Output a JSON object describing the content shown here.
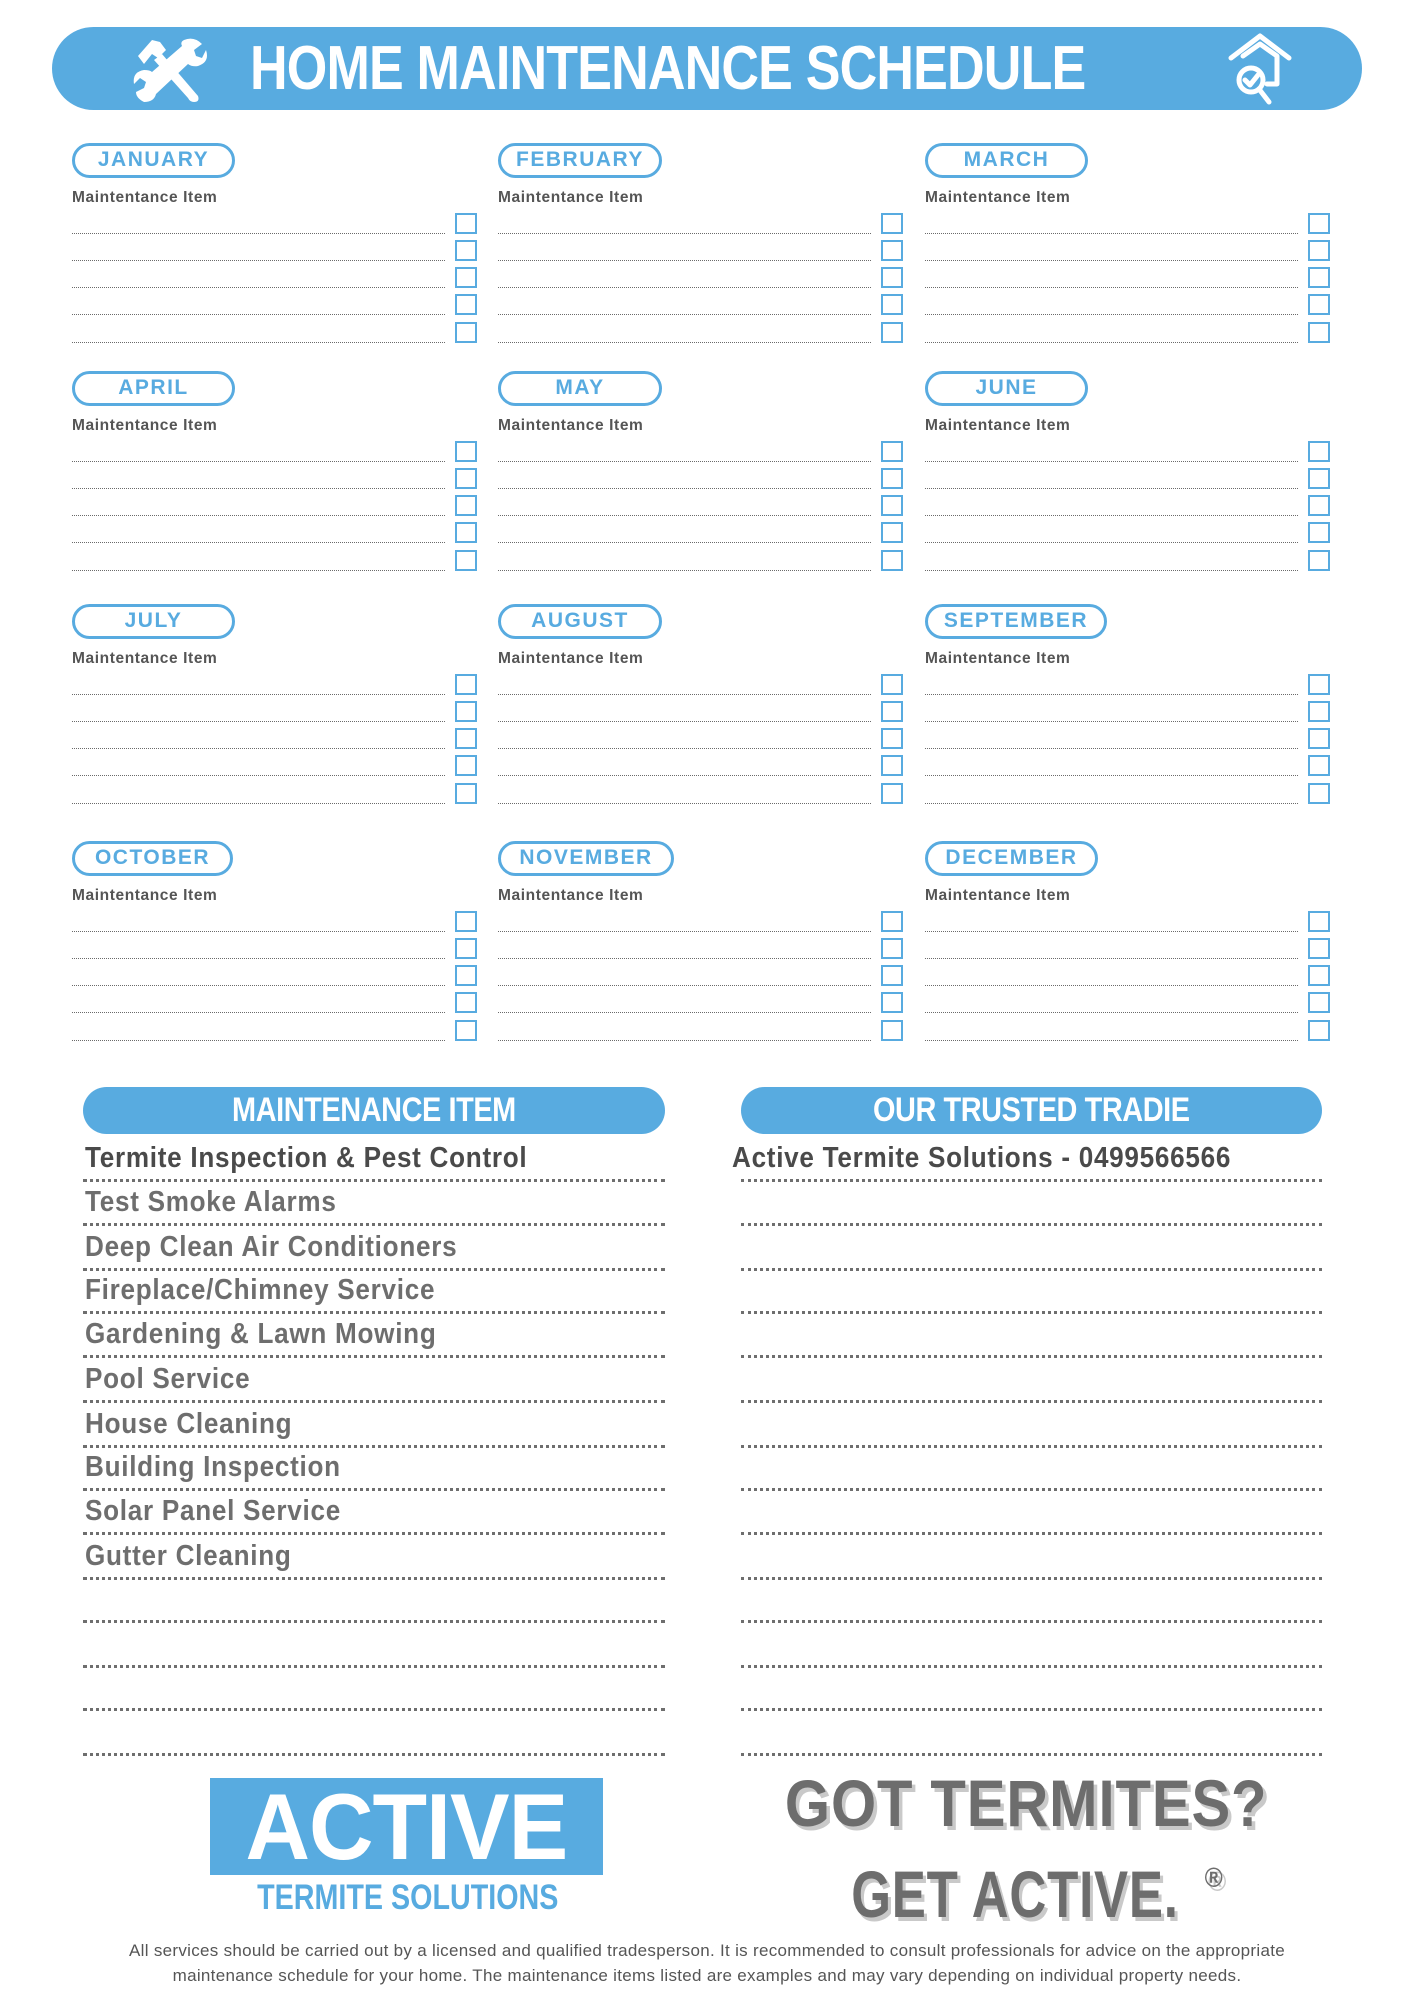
{
  "header": {
    "title": "HOME MAINTENANCE SCHEDULE",
    "left_icon": "tools-icon",
    "right_icon": "house-inspection-icon",
    "accent_color": "#58abe0"
  },
  "months": [
    {
      "name": "JANUARY",
      "label": "Maintentance Item",
      "rows": 5
    },
    {
      "name": "FEBRUARY",
      "label": "Maintentance Item",
      "rows": 5
    },
    {
      "name": "MARCH",
      "label": "Maintentance Item",
      "rows": 5
    },
    {
      "name": "APRIL",
      "label": "Maintentance Item",
      "rows": 5
    },
    {
      "name": "MAY",
      "label": "Maintentance Item",
      "rows": 5
    },
    {
      "name": "JUNE",
      "label": "Maintentance Item",
      "rows": 5
    },
    {
      "name": "JULY",
      "label": "Maintentance Item",
      "rows": 5
    },
    {
      "name": "AUGUST",
      "label": "Maintentance Item",
      "rows": 5
    },
    {
      "name": "SEPTEMBER",
      "label": "Maintentance Item",
      "rows": 5
    },
    {
      "name": "OCTOBER",
      "label": "Maintentance Item",
      "rows": 5
    },
    {
      "name": "NOVEMBER",
      "label": "Maintentance Item",
      "rows": 5
    },
    {
      "name": "DECEMBER",
      "label": "Maintentance Item",
      "rows": 5
    }
  ],
  "maintenance_list": {
    "title": "MAINTENANCE ITEM",
    "items": [
      "Termite Inspection & Pest Control",
      "Test Smoke Alarms",
      "Deep Clean Air Conditioners",
      "Fireplace/Chimney Service",
      "Gardening & Lawn Mowing",
      "Pool Service",
      "House Cleaning",
      "Building Inspection",
      "Solar Panel Service",
      "Gutter Cleaning",
      "",
      "",
      "",
      ""
    ]
  },
  "tradie_list": {
    "title": "OUR TRUSTED TRADIE",
    "items": [
      "Active Termite Solutions - 0499566566",
      "",
      "",
      "",
      "",
      "",
      "",
      "",
      "",
      "",
      "",
      "",
      "",
      ""
    ]
  },
  "logo": {
    "main": "ACTIVE",
    "sub": "TERMITE SOLUTIONS"
  },
  "slogan": {
    "line1": "GOT TERMITES?",
    "line2": "GET ACTIVE.",
    "mark": "®"
  },
  "disclaimer": {
    "line1": "All services should be carried out by a licensed and qualified tradesperson. It is recommended to consult professionals for advice on the appropriate",
    "line2": "maintenance schedule for your home. The maintenance items listed are examples and may vary depending on individual property needs."
  }
}
